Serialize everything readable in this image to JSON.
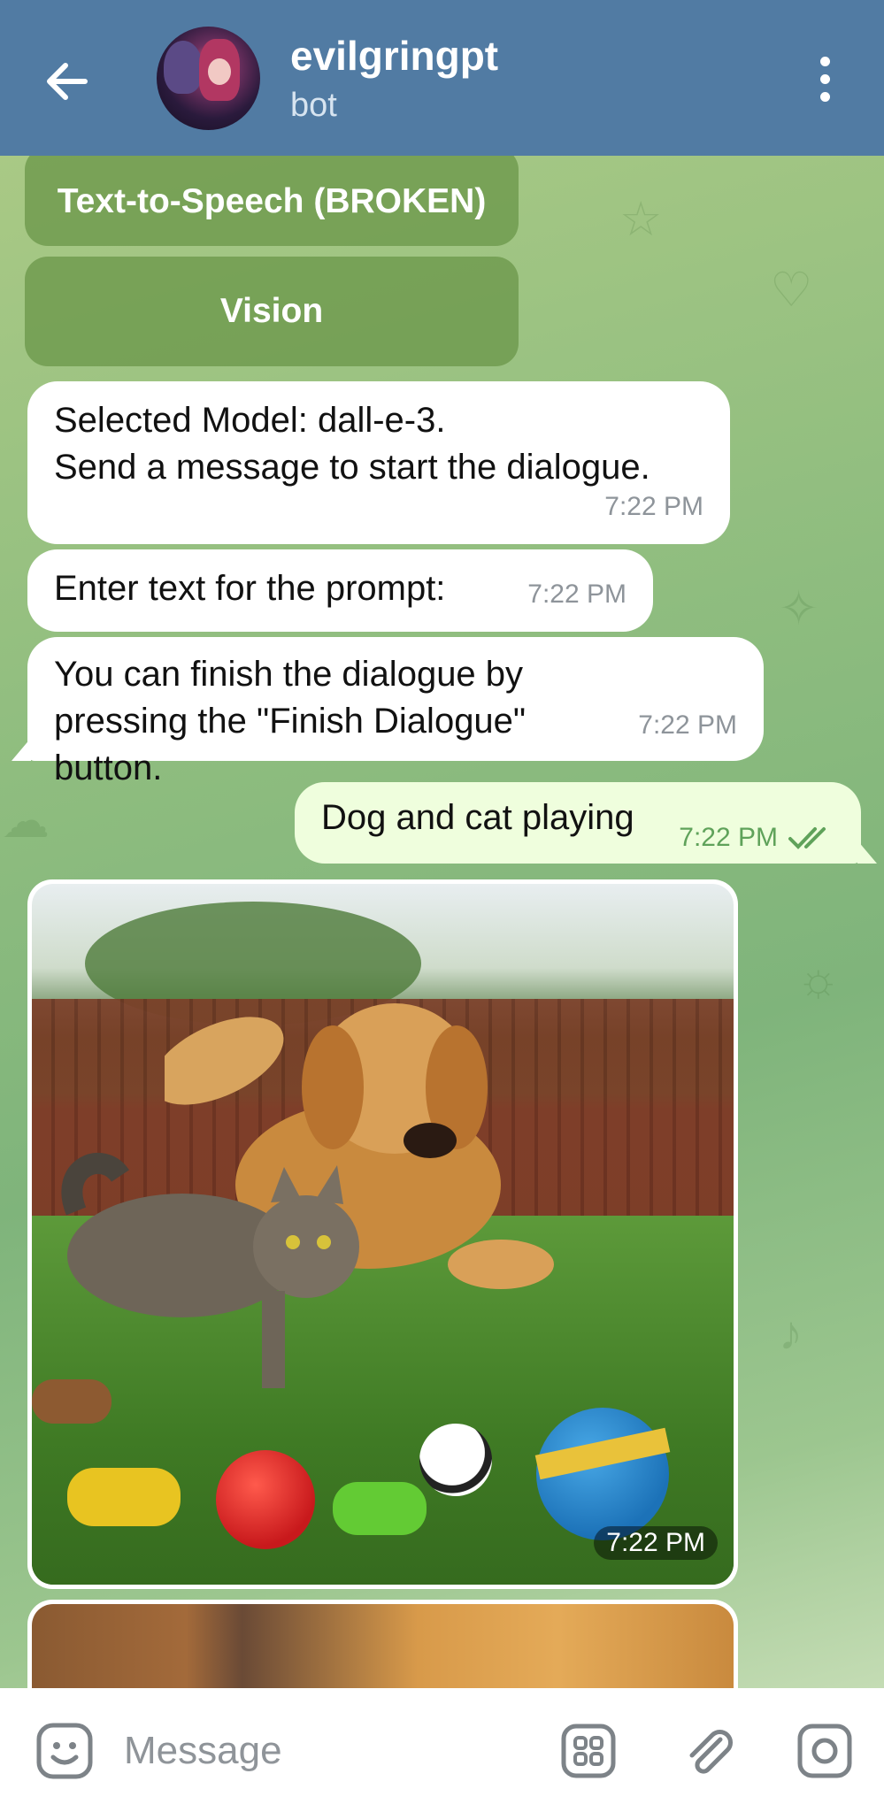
{
  "header": {
    "title": "evilgringpt",
    "subtitle": "bot"
  },
  "keyboard_buttons": [
    {
      "label": "Text-to-Speech (BROKEN)"
    },
    {
      "label": "Vision"
    }
  ],
  "messages": [
    {
      "text": "Selected Model: dall-e-3.\nSend a message to start the dialogue.",
      "time": "7:22 PM"
    },
    {
      "text": "Enter text for the prompt:",
      "time": "7:22 PM"
    },
    {
      "text": "You can finish the dialogue by pressing the \"Finish Dialogue\" button.",
      "time": "7:22 PM"
    }
  ],
  "outgoing": {
    "text": "Dog and cat playing",
    "time": "7:22 PM"
  },
  "image_message": {
    "time": "7:22 PM"
  },
  "input": {
    "placeholder": "Message"
  },
  "colors": {
    "header": "#517ba3",
    "outgoing_bubble": "#effedd",
    "incoming_bubble": "#ffffff",
    "read_checks": "#5fa25a"
  },
  "icons": [
    "back-arrow-icon",
    "menu-dots-icon",
    "double-check-icon",
    "emoji-icon",
    "commands-icon",
    "attach-icon",
    "camera-icon"
  ]
}
